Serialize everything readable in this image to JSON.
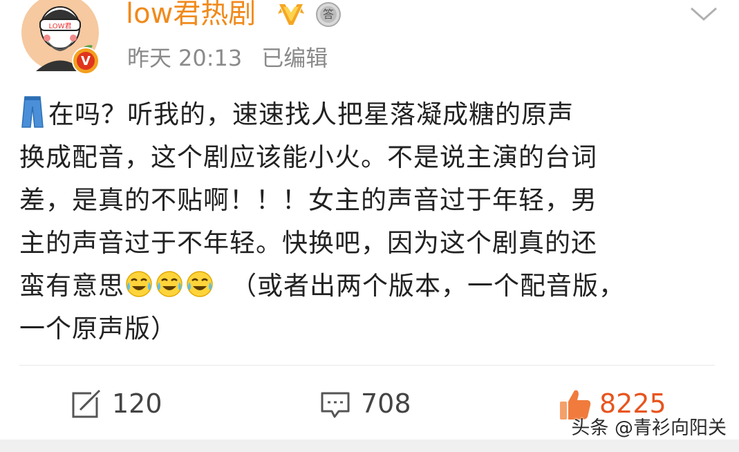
{
  "post": {
    "author": "low君热剧",
    "date": "昨天",
    "time": "20:13",
    "edited": "已编辑",
    "content_lines": [
      "在吗？听我的，速速找人把星落凝成糖的原声",
      "换成配音，这个剧应该能小火。不是说主演的台词",
      "差，是真的不贴啊！！！女主的声音过于年轻，男",
      "主的声音过于不年轻。快换吧，因为这个剧真的还",
      "蛮有意思",
      "（或者出两个版本，一个配音版，",
      "一个原声版）"
    ],
    "avatar_text": "LOW君",
    "verified_badge": "V",
    "answer_badge": "答"
  },
  "actions": {
    "repost_count": "120",
    "comment_count": "708",
    "like_count": "8225"
  },
  "watermark": "头条 @青衫向阳关",
  "colors": {
    "username": "#f08a1c",
    "like": "#e8541e",
    "meta": "#8a8a8a"
  },
  "icons": [
    "avatar",
    "vip-badge-icon",
    "answer-badge-icon",
    "chevron-down-icon",
    "jeans-emoji-icon",
    "laugh-cry-emoji-icon",
    "repost-icon",
    "comment-icon",
    "like-icon"
  ]
}
